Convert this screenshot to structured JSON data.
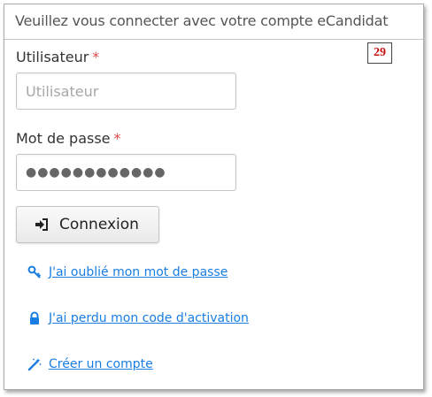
{
  "header": {
    "title": "Veuillez vous connecter avec votre compte eCandidat",
    "badge": "29"
  },
  "form": {
    "username": {
      "label": "Utilisateur",
      "required_mark": "*",
      "placeholder": "Utilisateur",
      "value": ""
    },
    "password": {
      "label": "Mot de passe",
      "required_mark": "*",
      "value": "●●●●●●●●●●●●"
    },
    "submit": {
      "label": "Connexion",
      "icon": "sign-in-icon"
    }
  },
  "links": [
    {
      "label": "J'ai oublié mon mot de passe",
      "icon": "key-icon"
    },
    {
      "label": "J'ai perdu mon code d'activation",
      "icon": "lock-icon"
    },
    {
      "label": "Créer un compte",
      "icon": "magic-wand-icon"
    }
  ],
  "colors": {
    "link": "#197de1",
    "required": "#e04848",
    "badge_text": "#cc1111"
  }
}
